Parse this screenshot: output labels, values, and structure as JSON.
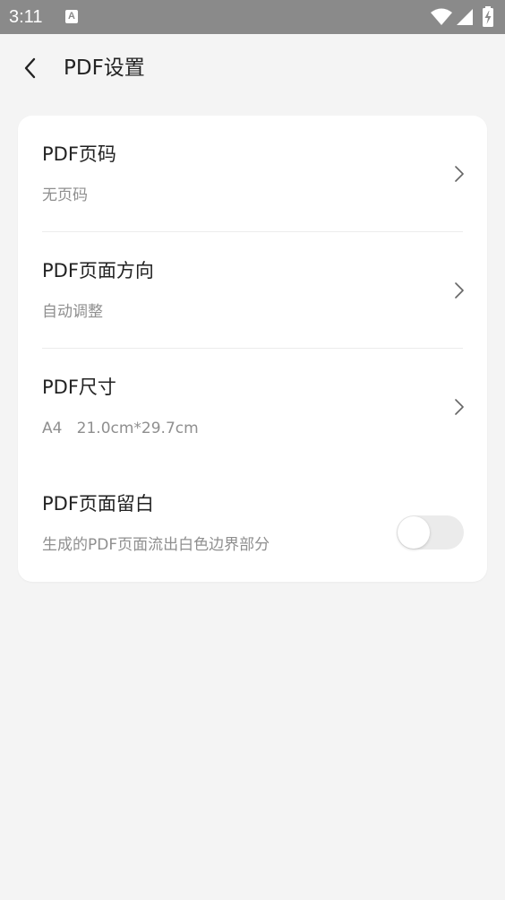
{
  "status_bar": {
    "time": "3:11",
    "notification_glyph": "A",
    "icons": [
      "wifi-icon",
      "signal-icon",
      "battery-charging-icon"
    ]
  },
  "header": {
    "title": "PDF设置",
    "back_icon": "chevron-left-icon"
  },
  "settings": {
    "page_number": {
      "title": "PDF页码",
      "value": "无页码"
    },
    "orientation": {
      "title": "PDF页面方向",
      "value": "自动调整"
    },
    "size": {
      "title": "PDF尺寸",
      "value": "A4   21.0cm*29.7cm"
    },
    "margin": {
      "title": "PDF页面留白",
      "description": "生成的PDF页面流出白色边界部分",
      "enabled": false
    }
  },
  "colors": {
    "status_bar_bg": "#8a8a8a",
    "page_bg": "#f4f4f4",
    "card_bg": "#ffffff",
    "secondary_text": "#8f8f8f",
    "toggle_off_track": "#ebebeb"
  }
}
